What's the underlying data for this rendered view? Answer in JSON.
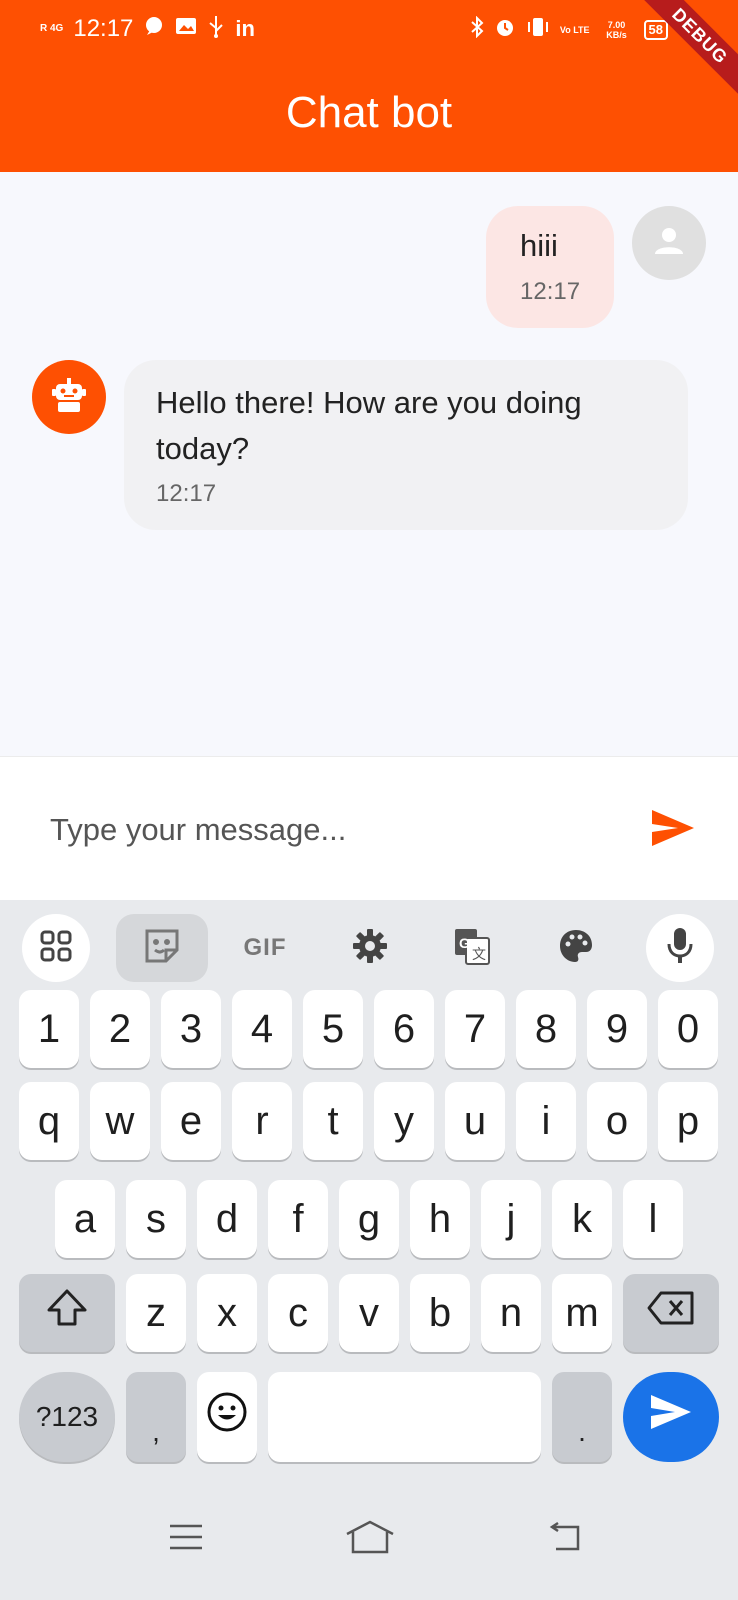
{
  "status_bar": {
    "network": "R 4G",
    "time": "12:17",
    "volte": "Vo LTE",
    "speed": "7.00 KB/s",
    "battery": "58",
    "icons": [
      "whatsapp-icon",
      "gallery-icon",
      "usb-icon",
      "linkedin-icon",
      "bluetooth-icon",
      "alarm-icon",
      "vibrate-icon",
      "volte-icon"
    ]
  },
  "app_bar": {
    "title": "Chat bot",
    "debug_banner": "DEBUG"
  },
  "colors": {
    "primary": "#fe5002",
    "user_bubble": "#fce6e4",
    "bot_bubble": "#f1f1f3",
    "send_blue": "#1a73e8"
  },
  "messages": [
    {
      "sender": "user",
      "text": "hiii",
      "time": "12:17"
    },
    {
      "sender": "bot",
      "text": "Hello there! How are you doing today?",
      "time": "12:17"
    }
  ],
  "input": {
    "placeholder": "Type your message...",
    "value": ""
  },
  "keyboard": {
    "toolbar": {
      "gif": "GIF",
      "icons": [
        "apps-icon",
        "sticker-icon",
        "gif-icon",
        "settings-icon",
        "translate-icon",
        "palette-icon",
        "mic-icon"
      ]
    },
    "row_numbers": [
      "1",
      "2",
      "3",
      "4",
      "5",
      "6",
      "7",
      "8",
      "9",
      "0"
    ],
    "row_top": [
      "q",
      "w",
      "e",
      "r",
      "t",
      "y",
      "u",
      "i",
      "o",
      "p"
    ],
    "row_middle": [
      "a",
      "s",
      "d",
      "f",
      "g",
      "h",
      "j",
      "k",
      "l"
    ],
    "row_bottom": [
      "z",
      "x",
      "c",
      "v",
      "b",
      "n",
      "m"
    ],
    "symbols_label": "?123",
    "comma": ",",
    "period": "."
  }
}
